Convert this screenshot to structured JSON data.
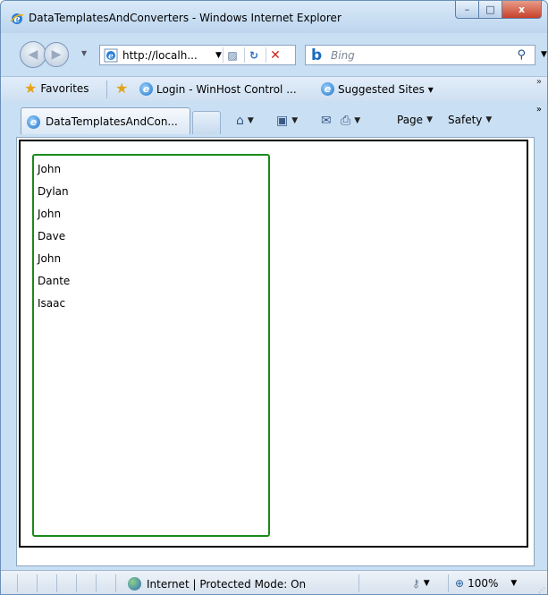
{
  "window": {
    "title": "DataTemplatesAndConverters - Windows Internet Explorer",
    "controls": {
      "minimize": "–",
      "maximize": "□",
      "close": "x"
    }
  },
  "nav": {
    "back_glyph": "◀",
    "forward_glyph": "▶",
    "address_prefix": "http://",
    "address_host": "localh...",
    "search_placeholder": "Bing",
    "search_logo": "b"
  },
  "favorites_bar": {
    "favorites_label": "Favorites",
    "links": [
      {
        "label": "Login - WinHost Control ..."
      },
      {
        "label": "Suggested Sites ▾"
      }
    ],
    "more": "»"
  },
  "tabs": {
    "active_tab": "DataTemplatesAndCon...",
    "commands": [
      {
        "label": "Page",
        "icon": "page-icon"
      },
      {
        "label": "Safety",
        "icon": "safety-icon"
      }
    ],
    "more": "»"
  },
  "content": {
    "list_items": [
      "John",
      "Dylan",
      "John",
      "Dave",
      "John",
      "Dante",
      "Isaac"
    ]
  },
  "status": {
    "zone": "Internet | Protected Mode: On",
    "zoom": "100%"
  },
  "colors": {
    "chrome": "#c9dff3",
    "listbox_border": "#1a8a1a",
    "frame_border": "#000000"
  }
}
